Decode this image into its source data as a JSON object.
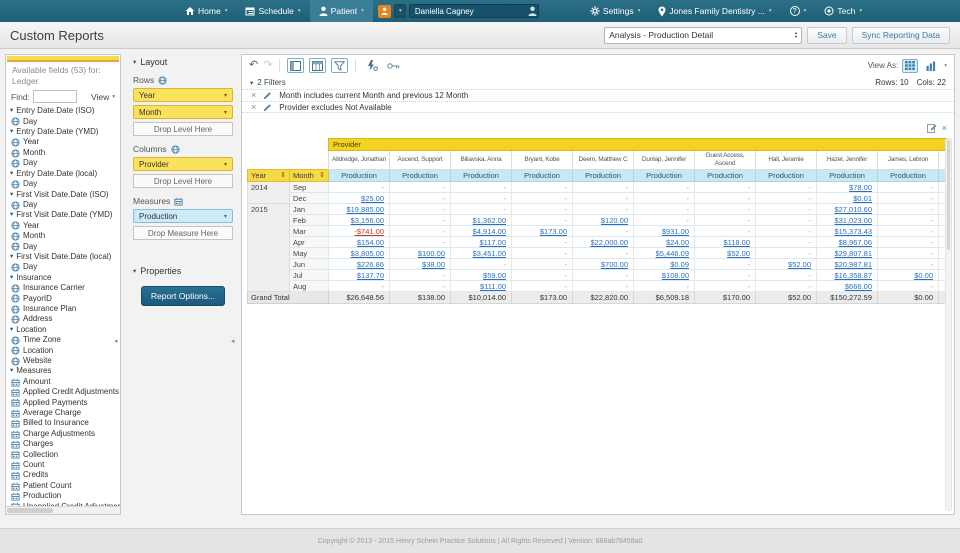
{
  "icons": {
    "chevron_down": "▾",
    "triangle_down": "▾",
    "triangle_up": "▴",
    "undo": "↶",
    "redo": "↷",
    "close": "×",
    "sort": "⇕",
    "collapse_left": "◂",
    "help": "?"
  },
  "colors": {
    "nav_teal": "#266a80",
    "accent_yellow": "#f3d322",
    "measure_blue": "#c5e9f5",
    "link_blue": "#2a70b8",
    "negative_red": "#c03a2e",
    "button_blue": "#1c5a7c"
  },
  "top_nav": {
    "items": [
      {
        "label": "Home"
      },
      {
        "label": "Schedule"
      },
      {
        "label": "Patient"
      }
    ],
    "search_value": "Daniella Cagney",
    "settings_label": "Settings",
    "location_label": "Jones Family Dentistry ...",
    "help_label": "?",
    "tech_label": "Tech"
  },
  "page_header": {
    "title": "Custom Reports",
    "report_select_value": "Analysis - Production Detail",
    "save_label": "Save",
    "sync_label": "Sync Reporting Data"
  },
  "sidebar": {
    "heading": "Available fields (53) for:",
    "source": "Ledger",
    "find_label": "Find:",
    "find_value": "",
    "view_label": "View",
    "groups": [
      {
        "label": "Entry Date.Date (ISO)",
        "measure": false,
        "fields": [
          "Day"
        ]
      },
      {
        "label": "Entry Date.Date (YMD)",
        "measure": false,
        "fields": [
          "Year",
          "Month",
          "Day"
        ]
      },
      {
        "label": "Entry Date.Date (local)",
        "measure": false,
        "fields": [
          "Day"
        ]
      },
      {
        "label": "First Visit Date.Date (ISO)",
        "measure": false,
        "fields": [
          "Day"
        ]
      },
      {
        "label": "First Visit Date.Date (YMD)",
        "measure": false,
        "fields": [
          "Year",
          "Month",
          "Day"
        ]
      },
      {
        "label": "First Visit Date.Date (local)",
        "measure": false,
        "fields": [
          "Day"
        ]
      },
      {
        "label": "Insurance",
        "measure": false,
        "fields": [
          "Insurance Carrier",
          "PayorID",
          "Insurance Plan",
          "Address"
        ]
      },
      {
        "label": "Location",
        "measure": false,
        "fields": [
          "Time Zone",
          "Location",
          "Website"
        ]
      },
      {
        "label": "Measures",
        "measure": true,
        "fields": [
          "Amount",
          "Applied Credit Adjustments",
          "Applied Payments",
          "Average Charge",
          "Billed to Insurance",
          "Charge Adjustments",
          "Charges",
          "Collection",
          "Count",
          "Credits",
          "Patient Count",
          "Production",
          "Unapplied Credit Adjustments"
        ]
      }
    ]
  },
  "layout_panel": {
    "title": "Layout",
    "rows_label": "Rows",
    "rows": [
      "Year",
      "Month"
    ],
    "columns_label": "Columns",
    "columns": [
      "Provider"
    ],
    "measures_label": "Measures",
    "measures": [
      "Production"
    ],
    "drop_level_label": "Drop Level Here",
    "drop_measure_label": "Drop Measure Here",
    "properties_title": "Properties",
    "report_options_label": "Report Options..."
  },
  "report": {
    "view_as_label": "View As:",
    "rows_count_label": "Rows: 10",
    "cols_count_label": "Cols: 22",
    "filters_title": "2 Filters",
    "filters": [
      "Month includes current Month and previous 12 Month",
      "Provider excludes Not Available"
    ]
  },
  "pivot_table": {
    "axis_label": "Provider",
    "row_headers": [
      "Year",
      "Month"
    ],
    "measure_label": "Production",
    "providers": [
      "Alldredge, Jonathan",
      "Ascend, Support",
      "Biliavska, Anna",
      "Bryant, Kobe",
      "Deem, Matthew C",
      "Dunlap, Jennifer",
      "Guest Access, Ascend",
      "Hall, Jeramie",
      "Hazel, Jennifer",
      "James, Lebron",
      "Je"
    ],
    "year_groups": [
      {
        "year": "2014",
        "months": [
          {
            "month": "Sep",
            "values": [
              "-",
              "-",
              "-",
              "-",
              "-",
              "-",
              "-",
              "-",
              "$78.00",
              "-"
            ]
          },
          {
            "month": "Dec",
            "values": [
              "$25.00",
              "-",
              "-",
              "-",
              "-",
              "-",
              "-",
              "-",
              "$0.01",
              "-"
            ]
          }
        ]
      },
      {
        "year": "2015",
        "months": [
          {
            "month": "Jan",
            "values": [
              "$19,885.00",
              "-",
              "-",
              "-",
              "-",
              "-",
              "-",
              "-",
              "$27,010.60",
              "-"
            ]
          },
          {
            "month": "Feb",
            "values": [
              "$3,156.00",
              "-",
              "$1,362.00",
              "-",
              "$120.00",
              "-",
              "-",
              "-",
              "$31,023.00",
              "-"
            ]
          },
          {
            "month": "Mar",
            "values": [
              "-$741.00",
              "-",
              "$4,914.00",
              "$173.00",
              "-",
              "$931.00",
              "-",
              "-",
              "$15,373.43",
              "-"
            ]
          },
          {
            "month": "Apr",
            "values": [
              "$154.00",
              "-",
              "$117.00",
              "-",
              "$22,000.00",
              "$24.00",
              "$118.00",
              "-",
              "$8,967.06",
              "-"
            ]
          },
          {
            "month": "May",
            "values": [
              "$3,805.00",
              "$100.00",
              "$3,451.00",
              "-",
              "-",
              "$5,446.09",
              "$52.00",
              "-",
              "$29,807.81",
              "-"
            ]
          },
          {
            "month": "Jun",
            "values": [
              "$226.86",
              "$38.00",
              "-",
              "-",
              "$700.00",
              "$0.09",
              "-",
              "$52.00",
              "$20,987.81",
              "-"
            ]
          },
          {
            "month": "Jul",
            "values": [
              "$137.70",
              "-",
              "$59.00",
              "-",
              "-",
              "$108.00",
              "-",
              "-",
              "$16,358.87",
              "$0.00"
            ]
          },
          {
            "month": "Aug",
            "values": [
              "-",
              "-",
              "$111.00",
              "-",
              "-",
              "-",
              "-",
              "-",
              "$666.00",
              "-"
            ]
          }
        ]
      }
    ],
    "grand_total": {
      "label": "Grand Total",
      "values": [
        "$26,648.56",
        "$138.00",
        "$10,014.00",
        "$173.00",
        "$22,820.00",
        "$6,509.18",
        "$170.00",
        "$52.00",
        "$150,272.59",
        "$0.00"
      ]
    }
  },
  "footer": {
    "text": "Copyright © 2013 - 2015 Henry Schein Practice Solutions | All Rights Reserved | Version: 888ab78458a0"
  }
}
